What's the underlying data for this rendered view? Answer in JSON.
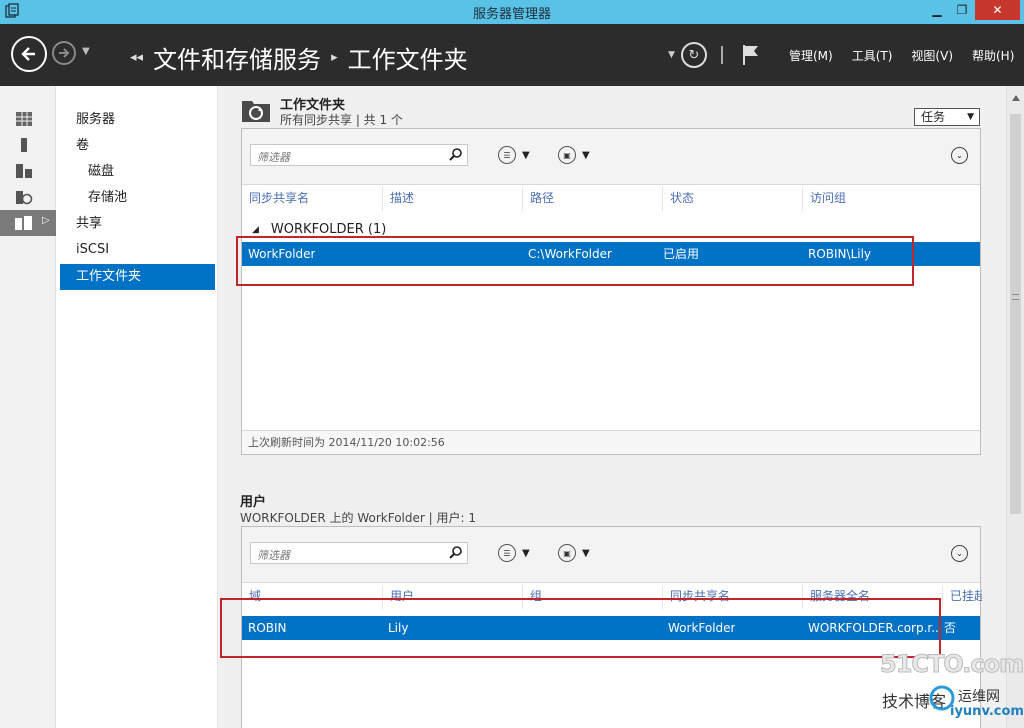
{
  "window": {
    "title": "服务器管理器"
  },
  "header": {
    "breadcrumb": [
      "文件和存储服务",
      "工作文件夹"
    ],
    "menu": [
      "管理(M)",
      "工具(T)",
      "视图(V)",
      "帮助(H)"
    ]
  },
  "nav": {
    "items": [
      {
        "label": "服务器",
        "selected": false
      },
      {
        "label": "卷",
        "selected": false
      },
      {
        "label": "磁盘",
        "selected": false
      },
      {
        "label": "存储池",
        "selected": false
      },
      {
        "label": "共享",
        "selected": false
      },
      {
        "label": "iSCSI",
        "selected": false
      },
      {
        "label": "工作文件夹",
        "selected": true
      }
    ]
  },
  "work_folders": {
    "title": "工作文件夹",
    "subtitle": "所有同步共享 | 共 1 个",
    "tasks_label": "任务",
    "filter_placeholder": "筛选器",
    "columns": [
      "同步共享名",
      "描述",
      "路径",
      "状态",
      "访问组"
    ],
    "group_label": "WORKFOLDER (1)",
    "rows": [
      {
        "name": "WorkFolder",
        "description": "",
        "path": "C:\\WorkFolder",
        "status": "已启用",
        "access_group": "ROBIN\\Lily"
      }
    ],
    "footer": "上次刷新时间为 2014/11/20 10:02:56"
  },
  "users": {
    "title": "用户",
    "subtitle": "WORKFOLDER 上的 WorkFolder | 用户: 1",
    "filter_placeholder": "筛选器",
    "columns": [
      "域",
      "用户",
      "组",
      "同步共享名",
      "服务器全名",
      "已挂起"
    ],
    "rows": [
      {
        "domain": "ROBIN",
        "user": "Lily",
        "group": "",
        "share": "WorkFolder",
        "server": "WORKFOLDER.corp.r...",
        "suspended": "否"
      }
    ]
  },
  "watermark": {
    "line1": "51CTO.com",
    "line2": "技术博客",
    "line3": "运维网",
    "line4": "iyunv.com"
  },
  "colors": {
    "titlebar": "#5bc2e7",
    "header": "#2c2c2c",
    "selection": "#0072c6",
    "highlight_box": "#c0262c"
  }
}
